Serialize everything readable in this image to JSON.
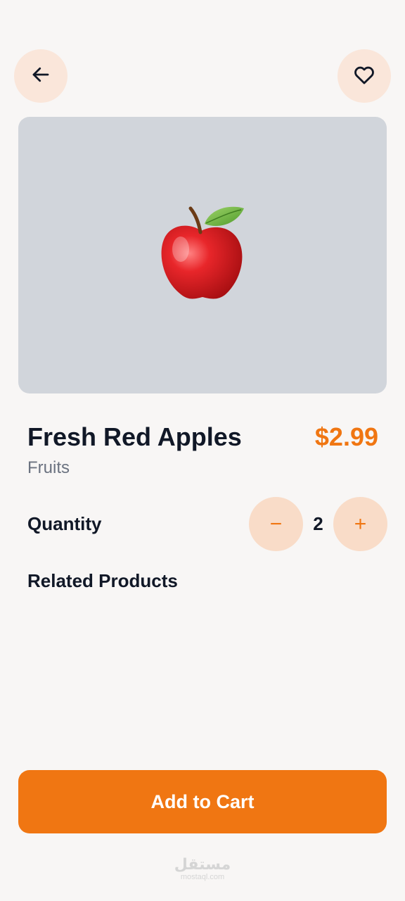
{
  "header": {
    "back_icon": "arrow-left-icon",
    "favorite_icon": "heart-outline-icon"
  },
  "product": {
    "image_icon": "red-apple-icon",
    "name": "Fresh Red Apples",
    "price": "$2.99",
    "category": "Fruits"
  },
  "quantity": {
    "label": "Quantity",
    "minus_label": "−",
    "plus_label": "+",
    "value": "2"
  },
  "related": {
    "title": "Related Products"
  },
  "footer": {
    "add_to_cart_label": "Add to Cart"
  },
  "watermark": {
    "main": "مستقل",
    "sub": "mostaql.com"
  },
  "colors": {
    "accent": "#f07612",
    "background": "#f8f6f5",
    "icon_button_bg": "#fae6da",
    "stepper_bg": "#f9dcc8",
    "image_bg": "#d1d5db",
    "text_dark": "#111827",
    "text_muted": "#6b7280"
  }
}
